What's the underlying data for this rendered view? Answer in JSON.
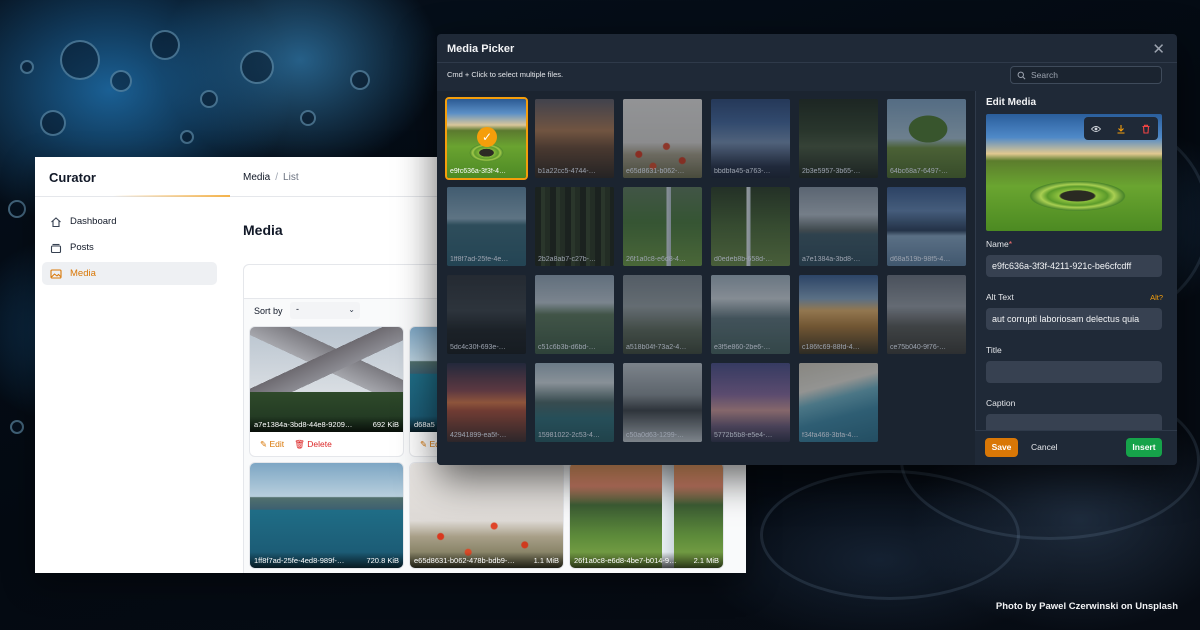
{
  "credit": "Photo by Pawel Czerwinski on Unsplash",
  "curator": {
    "logo": "Curator",
    "breadcrumb": [
      "Media",
      "List"
    ],
    "nav": [
      {
        "label": "Dashboard",
        "icon": "home-icon"
      },
      {
        "label": "Posts",
        "icon": "stack-icon"
      },
      {
        "label": "Media",
        "icon": "image-icon",
        "active": true
      }
    ],
    "page_title": "Media",
    "sort_label": "Sort by",
    "sort_value": "-",
    "edit_label": "Edit",
    "delete_label": "Delete",
    "cards": [
      {
        "name": "a7e1384a-3bd8-44e8-9209…",
        "size": "692 KiB",
        "image": "mountains"
      },
      {
        "name": "d68a5",
        "size": "",
        "image": "lake"
      },
      {
        "name": "1ff8f7ad-25fe-4ed8-989f-…",
        "size": "720.8 KiB",
        "image": "lake"
      },
      {
        "name": "e65d8631-b062-478b-bdb9-…",
        "size": "1.1 MiB",
        "image": "poppy"
      },
      {
        "name": "26f1a0c8-e6d8-4be7-b014-9…",
        "size": "2.1 MiB",
        "image": "waterfall"
      }
    ]
  },
  "picker": {
    "title": "Media Picker",
    "hint": "Cmd + Click to select multiple files.",
    "search_placeholder": "Search",
    "tiles": [
      {
        "label": "e9fc636a-3f3f-4…",
        "image": "green-circle",
        "selected": true
      },
      {
        "label": "b1a22cc5-4744-…",
        "image": "sunset-hill"
      },
      {
        "label": "e65d8631-b062-…",
        "image": "poppy"
      },
      {
        "label": "bbdbfa45-a763-…",
        "image": "blue-storm"
      },
      {
        "label": "2b3e5957-3b65-…",
        "image": "forest-bridge"
      },
      {
        "label": "64bc68a7-6497-…",
        "image": "tree"
      },
      {
        "label": "1ff8f7ad-25fe-4e…",
        "image": "teal-lake"
      },
      {
        "label": "2b2a8ab7-c27b-…",
        "image": "dark-forest"
      },
      {
        "label": "26f1a0c8-e6d8-4…",
        "image": "waterfall-green"
      },
      {
        "label": "d0edeb8b-658d-…",
        "image": "tall-falls"
      },
      {
        "label": "a7e1384a-3bd8-…",
        "image": "fjord"
      },
      {
        "label": "d68a519b-98f5-4…",
        "image": "blue-mtn"
      },
      {
        "label": "5dc4c30f-693e-…",
        "image": "dark-peaks"
      },
      {
        "label": "c51c6b3b-d6bd-…",
        "image": "green-valley"
      },
      {
        "label": "a518b04f-73a2-4…",
        "image": "mist"
      },
      {
        "label": "e3f5e860-2be6-…",
        "image": "valley2"
      },
      {
        "label": "c186fc69-88fd-4…",
        "image": "golden"
      },
      {
        "label": "ce75b040-9f76-…",
        "image": "rocky"
      },
      {
        "label": "42941899-ea5f-…",
        "image": "red-sunset"
      },
      {
        "label": "15981022-2c53-4…",
        "image": "alpine"
      },
      {
        "label": "c50a0d63-1299-…",
        "image": "cloudy-peaks"
      },
      {
        "label": "5772b5b8-e5e4-…",
        "image": "purple-sky"
      },
      {
        "label": "f34fa468-3bfa-4…",
        "image": "beach"
      }
    ],
    "edit": {
      "title": "Edit Media",
      "tools": [
        "eye-icon",
        "download-icon",
        "trash-icon"
      ],
      "name_label": "Name",
      "name_required": "*",
      "name_value": "e9fc636a-3f3f-4211-921c-be6cfcdff",
      "alt_label": "Alt Text",
      "alt_link": "Alt?",
      "alt_value": "aut corrupti laboriosam delectus quia",
      "title_label": "Title",
      "title_value": "",
      "caption_label": "Caption",
      "caption_value": ""
    },
    "buttons": {
      "save": "Save",
      "cancel": "Cancel",
      "insert": "Insert"
    }
  }
}
